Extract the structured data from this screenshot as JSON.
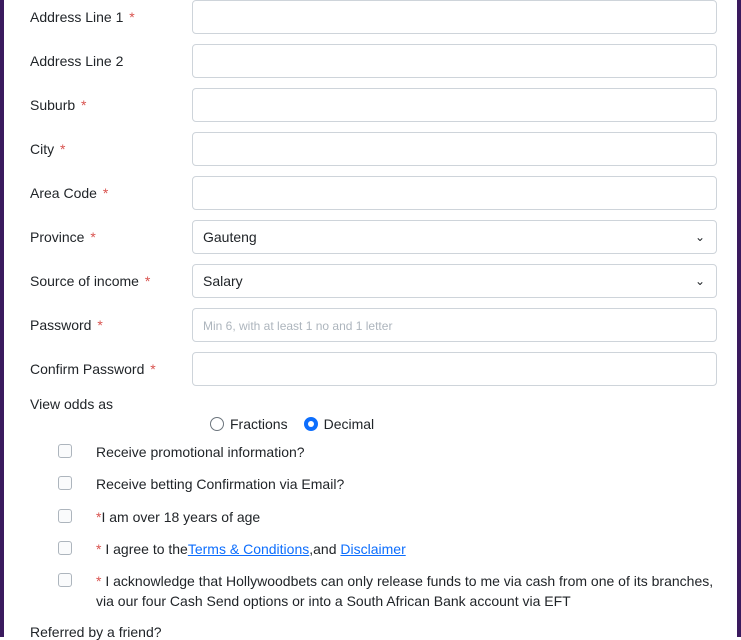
{
  "fields": {
    "address1": {
      "label": "Address Line 1",
      "required": true,
      "value": ""
    },
    "address2": {
      "label": "Address Line 2",
      "required": false,
      "value": ""
    },
    "suburb": {
      "label": "Suburb",
      "required": true,
      "value": ""
    },
    "city": {
      "label": "City",
      "required": true,
      "value": ""
    },
    "areacode": {
      "label": "Area Code",
      "required": true,
      "value": ""
    },
    "province": {
      "label": "Province",
      "required": true,
      "value": "Gauteng"
    },
    "income": {
      "label": "Source of income",
      "required": true,
      "value": "Salary"
    },
    "password": {
      "label": "Password",
      "required": true,
      "placeholder": "Min 6, with at least 1 no and 1 letter"
    },
    "confirm": {
      "label": "Confirm Password",
      "required": true,
      "value": ""
    }
  },
  "odds": {
    "label": "View odds as",
    "options": {
      "fractions": "Fractions",
      "decimal": "Decimal"
    },
    "selected": "decimal"
  },
  "checks": {
    "promo": "Receive promotional information?",
    "betmail": "Receive betting Confirmation via Email?",
    "over18": "I am over 18 years of age",
    "agree_pre": " I agree to the",
    "terms_link": "Terms & Conditions",
    "and_sep": ",and ",
    "disclaimer_link": "Disclaimer",
    "acknowledge": " I acknowledge that Hollywoodbets can only release funds to me via cash from one of its branches, via our four Cash Send options or into a South African Bank account via EFT"
  },
  "referred_label": "Referred by a friend?",
  "asterisk": "*"
}
